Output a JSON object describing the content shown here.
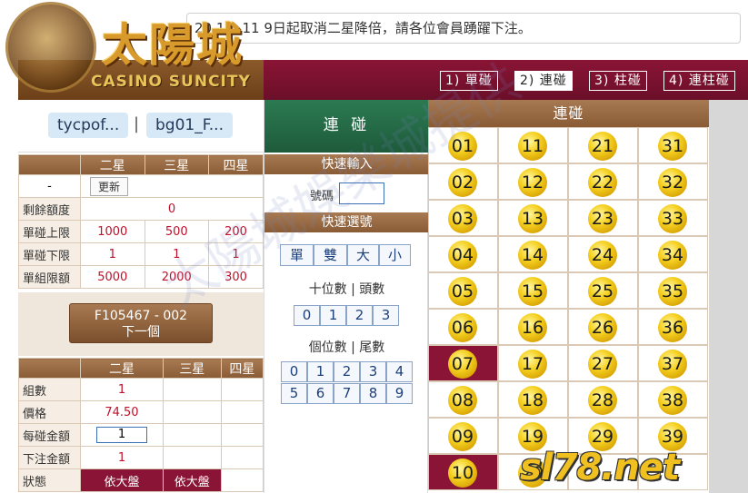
{
  "marquee": {
    "text": "20 1 9 11 9日起取消二星降倍，請各位會員踴躍下注。"
  },
  "logo": {
    "title": "太陽城",
    "subtitle": "CASINO SUNCITY"
  },
  "tabs": [
    "1) 單碰",
    "2) 連碰",
    "3) 柱碰",
    "4) 連柱碰"
  ],
  "active_tab": 1,
  "users": [
    "tycpof...",
    "bg01_F..."
  ],
  "limits": {
    "headers": [
      "",
      "二星",
      "三星",
      "四星"
    ],
    "update_label": "更新",
    "dash": "-",
    "rows": [
      {
        "label": "剩餘額度",
        "value": "0"
      },
      {
        "label": "單碰上限",
        "values": [
          "1000",
          "500",
          "200"
        ]
      },
      {
        "label": "單碰下限",
        "values": [
          "1",
          "1",
          "1"
        ]
      },
      {
        "label": "單組限額",
        "values": [
          "5000",
          "2000",
          "300"
        ]
      }
    ]
  },
  "next": {
    "code": "F105467 - 002",
    "label": "下一個"
  },
  "bet": {
    "headers": [
      "",
      "二星",
      "三星",
      "四星"
    ],
    "rows": [
      {
        "label": "組數",
        "value": "1"
      },
      {
        "label": "價格",
        "value": "74.50"
      },
      {
        "label": "每碰金額",
        "value": "1"
      },
      {
        "label": "下注金額",
        "value": "1"
      },
      {
        "label": "狀態",
        "values": [
          "依大盤",
          "依大盤"
        ]
      }
    ]
  },
  "mid": {
    "title": "連 碰",
    "quick_input": "快速輸入",
    "number_label": "號碼",
    "quick_select": "快速選號",
    "parity_buttons": [
      "單",
      "雙",
      "大",
      "小"
    ],
    "tens_label": "十位數 | 頭數",
    "tens_digits": [
      "0",
      "1",
      "2",
      "3"
    ],
    "ones_label": "個位數 | 尾數",
    "ones_digits": [
      "0",
      "1",
      "2",
      "3",
      "4",
      "5",
      "6",
      "7",
      "8",
      "9"
    ]
  },
  "numbers": {
    "title": "連碰",
    "rows": [
      [
        "01",
        "11",
        "21",
        "31"
      ],
      [
        "02",
        "12",
        "22",
        "32"
      ],
      [
        "03",
        "13",
        "23",
        "33"
      ],
      [
        "04",
        "14",
        "24",
        "34"
      ],
      [
        "05",
        "15",
        "25",
        "35"
      ],
      [
        "06",
        "16",
        "26",
        "36"
      ],
      [
        "07",
        "17",
        "27",
        "37"
      ],
      [
        "08",
        "18",
        "28",
        "38"
      ],
      [
        "09",
        "19",
        "29",
        "39"
      ],
      [
        "10",
        "20",
        "",
        ""
      ]
    ],
    "selected": [
      "07",
      "10"
    ]
  },
  "watermarks": {
    "diagonal": "太陽城娛樂城提供",
    "brand": "sl78.net"
  },
  "colors": {
    "maroon": "#8a1435",
    "brown": "#8a5c36",
    "green": "#1e5b3b",
    "ball": "#f5d020"
  }
}
